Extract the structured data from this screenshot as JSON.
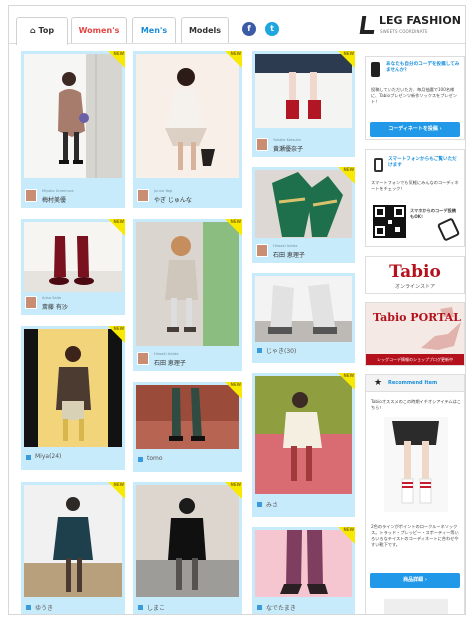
{
  "tabs": [
    {
      "label": "Top",
      "active": true
    },
    {
      "label": "Women's",
      "color": "#e24545"
    },
    {
      "label": "Men's",
      "color": "#1b8cd6"
    },
    {
      "label": "Models",
      "color": "#333333"
    }
  ],
  "social": {
    "facebook": "f",
    "twitter": "t"
  },
  "logo": {
    "title": "LEG FASHION",
    "subtitle": "SWEETS COORDINATE"
  },
  "new_badge": "NEW",
  "cards": [
    {
      "small": "Miyako Umemura",
      "name": "梅村美優"
    },
    {
      "small": "Junna Yagi",
      "name": "やぎ じゅんな"
    },
    {
      "small": "Yukako Kotsuka",
      "name": "黄瀬優奈子"
    },
    {
      "small": "Arisa Saito",
      "name": "斎藤 有沙"
    },
    {
      "small": "Hiroaki Ishida",
      "name": "石田 恵理子"
    },
    {
      "small": "Hiroaki Ishida",
      "name": "石田 恵理子"
    },
    {
      "name": "じゃき(30)"
    },
    {
      "name": "Miya(24)"
    },
    {
      "name": "tomo"
    },
    {
      "name": "みさ"
    },
    {
      "name": "ゆうき"
    },
    {
      "name": "しまこ"
    },
    {
      "name": "なでたまき"
    }
  ],
  "sidebar": {
    "campaign": {
      "title": "あなたも自分のコーデを投稿してみませんか？",
      "text": "投稿していただいた方、毎月抽選で100名様に、Tabioプレゼンツ新作ソックスをプレゼント！",
      "button": "コーディネートを投稿"
    },
    "phone": {
      "title": "スマートフォンからもご覧いただけます",
      "text": "スマートフォンでも気軽にみんなのコーディネートをチェック！",
      "qr_caption": "スマホからのコーデ投稿もOK！"
    },
    "tabio": {
      "brand": "Tabio",
      "sub": "オンラインストア"
    },
    "portal": {
      "title": "Tabio PORTAL",
      "banner": "レッグコーデ情報のショップブログ更新中"
    },
    "recommend": {
      "title": "Recommend Item",
      "intro": "Tabioオススメのこの時期イチオシアイテムはこちら！",
      "description": "2色のラインがポイントのロークルーネソックス。トラッド・プレッピー・スポーティー等いろいろなテイストのコーディネートに合わせやすい靴下です。",
      "button": "商品詳細"
    }
  },
  "colors": {
    "card_blue": "#c8ebfb",
    "button_blue": "#2199e8",
    "new_yellow": "#f7ea00"
  }
}
